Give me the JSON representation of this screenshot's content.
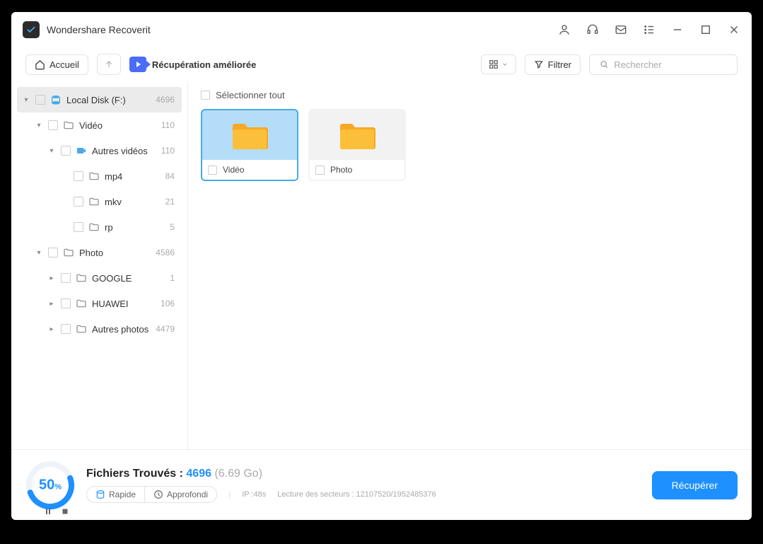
{
  "header": {
    "app_title": "Wondershare Recoverit"
  },
  "toolbar": {
    "home_label": "Accueil",
    "mode_label": "Récupération améliorée",
    "filter_label": "Filtrer",
    "search_placeholder": "Rechercher"
  },
  "tree": [
    {
      "label": "Local Disk (F:)",
      "count": "4696",
      "indent": 0,
      "expanded": true,
      "icon": "disk",
      "selected": true,
      "caret": "down"
    },
    {
      "label": "Vidéo",
      "count": "110",
      "indent": 1,
      "expanded": true,
      "icon": "folder",
      "caret": "down"
    },
    {
      "label": "Autres vidéos",
      "count": "110",
      "indent": 2,
      "expanded": true,
      "icon": "video",
      "caret": "down"
    },
    {
      "label": "mp4",
      "count": "84",
      "indent": 3,
      "icon": "folder",
      "caret": ""
    },
    {
      "label": "mkv",
      "count": "21",
      "indent": 3,
      "icon": "folder",
      "caret": ""
    },
    {
      "label": "rp",
      "count": "5",
      "indent": 3,
      "icon": "folder",
      "caret": ""
    },
    {
      "label": "Photo",
      "count": "4586",
      "indent": 1,
      "expanded": true,
      "icon": "folder",
      "caret": "down"
    },
    {
      "label": "GOOGLE",
      "count": "1",
      "indent": 2,
      "icon": "folder",
      "caret": "right"
    },
    {
      "label": "HUAWEI",
      "count": "106",
      "indent": 2,
      "icon": "folder",
      "caret": "right"
    },
    {
      "label": "Autres photos",
      "count": "4479",
      "indent": 2,
      "icon": "folder",
      "caret": "right"
    }
  ],
  "main": {
    "select_all_label": "Sélectionner tout",
    "folders": [
      {
        "name": "Vidéo",
        "selected": true
      },
      {
        "name": "Photo",
        "selected": false
      }
    ]
  },
  "footer": {
    "progress_pct": "50",
    "files_found_label": "Fichiers Trouvés : ",
    "files_found_num": "4696",
    "files_found_size": "(6.69 Go)",
    "fast_label": "Rapide",
    "deep_label": "Approfondi",
    "ip_label": "IP :48s",
    "sector_label": "Lecture des secteurs : 12107520/1952485376",
    "recover_label": "Récupérer"
  }
}
